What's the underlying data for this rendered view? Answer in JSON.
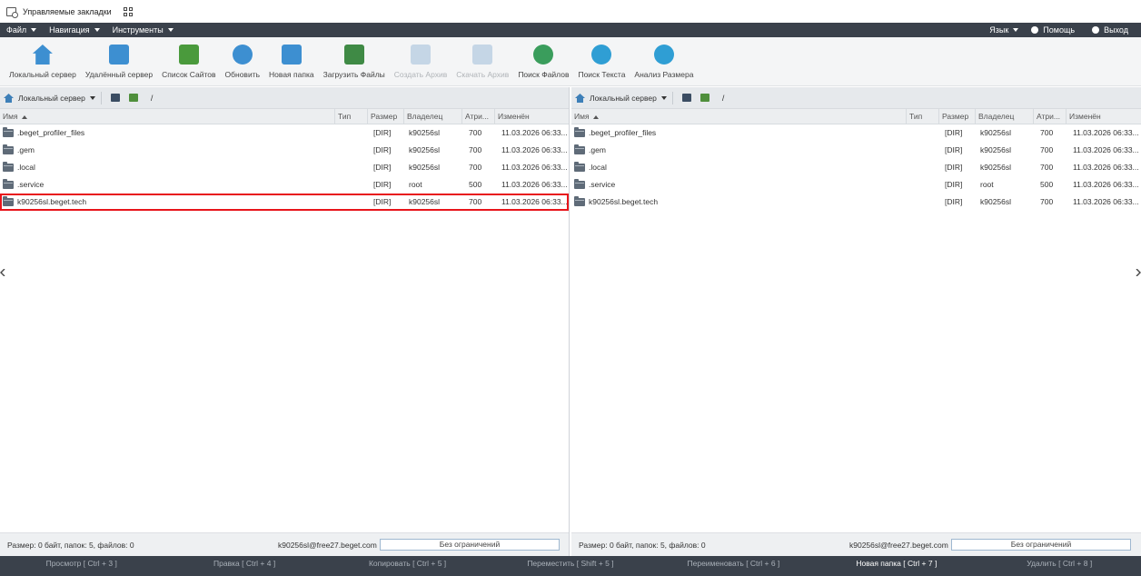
{
  "bookmarks": {
    "label": "Управляемые закладки"
  },
  "menu": {
    "left": [
      {
        "label": "Файл"
      },
      {
        "label": "Навигация"
      },
      {
        "label": "Инструменты"
      }
    ],
    "right": [
      {
        "label": "Язык",
        "type": "dropdown"
      },
      {
        "label": "Помощь",
        "icon": "help-icon"
      },
      {
        "label": "Выход",
        "icon": "power-icon"
      }
    ]
  },
  "toolbar": [
    {
      "label": "Локальный сервер",
      "icon": "home-server-icon",
      "color": "#3d8fd1",
      "disabled": false
    },
    {
      "label": "Удалённый сервер",
      "icon": "remote-server-icon",
      "color": "#3d8fd1",
      "disabled": false
    },
    {
      "label": "Список Сайтов",
      "icon": "sites-list-icon",
      "color": "#4a9a3c",
      "disabled": false
    },
    {
      "label": "Обновить",
      "icon": "refresh-icon",
      "color": "#3d8fd1",
      "disabled": false
    },
    {
      "label": "Новая папка",
      "icon": "new-folder-icon",
      "color": "#3d8fd1",
      "disabled": false
    },
    {
      "label": "Загрузить Файлы",
      "icon": "upload-icon",
      "color": "#3f8a45",
      "disabled": false
    },
    {
      "label": "Создать Архив",
      "icon": "archive-icon",
      "color": "#8cb0d3",
      "disabled": true
    },
    {
      "label": "Скачать Архив",
      "icon": "download-archive-icon",
      "color": "#8cb0d3",
      "disabled": true
    },
    {
      "label": "Поиск Файлов",
      "icon": "search-files-icon",
      "color": "#3a9d5c",
      "disabled": false
    },
    {
      "label": "Поиск Текста",
      "icon": "search-text-icon",
      "color": "#2f9ed4",
      "disabled": false
    },
    {
      "label": "Анализ Размера",
      "icon": "size-analysis-icon",
      "color": "#2f9ed4",
      "disabled": false
    }
  ],
  "panels": [
    {
      "id": "left",
      "server": "Локальный сервер",
      "path": "/",
      "columns": [
        "Имя",
        "Тип",
        "Размер",
        "Владелец",
        "Атри...",
        "Изменён"
      ],
      "rows": [
        {
          "name": ".beget_profiler_files",
          "type": "",
          "size": "[DIR]",
          "owner": "k90256sl",
          "attr": "700",
          "modified": "11.03.2026 06:33...",
          "selected": false
        },
        {
          "name": ".gem",
          "type": "",
          "size": "[DIR]",
          "owner": "k90256sl",
          "attr": "700",
          "modified": "11.03.2026 06:33...",
          "selected": false
        },
        {
          "name": ".local",
          "type": "",
          "size": "[DIR]",
          "owner": "k90256sl",
          "attr": "700",
          "modified": "11.03.2026 06:33...",
          "selected": false
        },
        {
          "name": ".service",
          "type": "",
          "size": "[DIR]",
          "owner": "root",
          "attr": "500",
          "modified": "11.03.2026 06:33...",
          "selected": false
        },
        {
          "name": "k90256sl.beget.tech",
          "type": "",
          "size": "[DIR]",
          "owner": "k90256sl",
          "attr": "700",
          "modified": "11.03.2026 06:33...",
          "selected": true
        }
      ],
      "status": {
        "text": "Размер: 0 байт, папок: 5, файлов: 0",
        "user": "k90256sl@free27.beget.com",
        "limit": "Без ограничений"
      }
    },
    {
      "id": "right",
      "server": "Локальный сервер",
      "path": "/",
      "columns": [
        "Имя",
        "Тип",
        "Размер",
        "Владелец",
        "Атри...",
        "Изменён"
      ],
      "rows": [
        {
          "name": ".beget_profiler_files",
          "type": "",
          "size": "[DIR]",
          "owner": "k90256sl",
          "attr": "700",
          "modified": "11.03.2026 06:33...",
          "selected": false
        },
        {
          "name": ".gem",
          "type": "",
          "size": "[DIR]",
          "owner": "k90256sl",
          "attr": "700",
          "modified": "11.03.2026 06:33...",
          "selected": false
        },
        {
          "name": ".local",
          "type": "",
          "size": "[DIR]",
          "owner": "k90256sl",
          "attr": "700",
          "modified": "11.03.2026 06:33...",
          "selected": false
        },
        {
          "name": ".service",
          "type": "",
          "size": "[DIR]",
          "owner": "root",
          "attr": "500",
          "modified": "11.03.2026 06:33...",
          "selected": false
        },
        {
          "name": "k90256sl.beget.tech",
          "type": "",
          "size": "[DIR]",
          "owner": "k90256sl",
          "attr": "700",
          "modified": "11.03.2026 06:33...",
          "selected": false
        }
      ],
      "status": {
        "text": "Размер: 0 байт, папок: 5, файлов: 0",
        "user": "k90256sl@free27.beget.com",
        "limit": "Без ограничений"
      }
    }
  ],
  "function_bar": [
    {
      "label": "Просмотр [ Ctrl + 3 ]",
      "active": false
    },
    {
      "label": "Правка [ Ctrl + 4 ]",
      "active": false
    },
    {
      "label": "Копировать [ Ctrl + 5 ]",
      "active": false
    },
    {
      "label": "Переместить [ Shift + 5 ]",
      "active": false
    },
    {
      "label": "Переименовать [ Ctrl + 6 ]",
      "active": false
    },
    {
      "label": "Новая папка [ Ctrl + 7 ]",
      "active": true
    },
    {
      "label": "Удалить [ Ctrl + 8 ]",
      "active": false
    }
  ],
  "colors": {
    "menubar": "#3a414b",
    "selection_outline": "#e8151b",
    "pathbar": "#e6e9ec"
  }
}
